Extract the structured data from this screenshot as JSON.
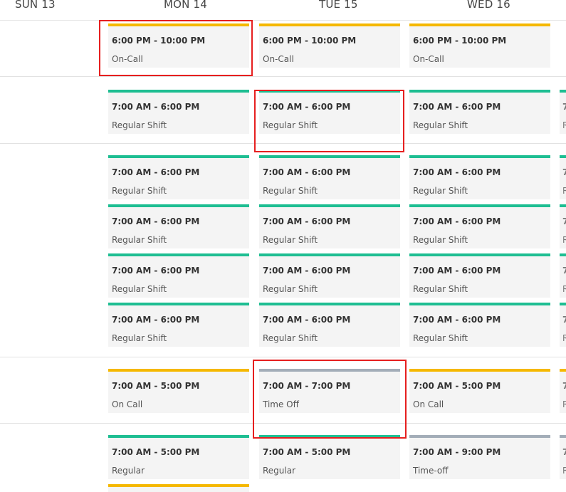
{
  "colors": {
    "regular": "#1ebe92",
    "oncall": "#f5b800",
    "timeoff": "#a3adb8",
    "highlight": "#e61f1f",
    "card_bg": "#f4f4f4"
  },
  "days": [
    {
      "label": "SUN 13"
    },
    {
      "label": "MON 14"
    },
    {
      "label": "TUE 15"
    },
    {
      "label": "WED 16"
    }
  ],
  "rows": [
    {
      "shifts": [
        {
          "time": "6:00 PM - 10:00 PM",
          "label": "On-Call",
          "color": "#f5b800"
        },
        {
          "time": "6:00 PM - 10:00 PM",
          "label": "On-Call",
          "color": "#f5b800"
        },
        {
          "time": "6:00 PM - 10:00 PM",
          "label": "On-Call",
          "color": "#f5b800"
        }
      ]
    },
    {
      "shifts": [
        {
          "time": "7:00 AM - 6:00 PM",
          "label": "Regular Shift",
          "color": "#1ebe92"
        },
        {
          "time": "7:00 AM - 6:00 PM",
          "label": "Regular Shift",
          "color": "#1ebe92"
        },
        {
          "time": "7:00 AM - 6:00 PM",
          "label": "Regular Shift",
          "color": "#1ebe92"
        }
      ]
    },
    {
      "shifts": [
        {
          "time": "7:00 AM - 6:00 PM",
          "label": "Regular Shift",
          "color": "#1ebe92"
        },
        {
          "time": "7:00 AM - 6:00 PM",
          "label": "Regular Shift",
          "color": "#1ebe92"
        },
        {
          "time": "7:00 AM - 6:00 PM",
          "label": "Regular Shift",
          "color": "#1ebe92"
        }
      ]
    },
    {
      "shifts": [
        {
          "time": "7:00 AM - 6:00 PM",
          "label": "Regular Shift",
          "color": "#1ebe92"
        },
        {
          "time": "7:00 AM - 6:00 PM",
          "label": "Regular Shift",
          "color": "#1ebe92"
        },
        {
          "time": "7:00 AM - 6:00 PM",
          "label": "Regular Shift",
          "color": "#1ebe92"
        }
      ]
    },
    {
      "shifts": [
        {
          "time": "7:00 AM - 6:00 PM",
          "label": "Regular Shift",
          "color": "#1ebe92"
        },
        {
          "time": "7:00 AM - 6:00 PM",
          "label": "Regular Shift",
          "color": "#1ebe92"
        },
        {
          "time": "7:00 AM - 6:00 PM",
          "label": "Regular Shift",
          "color": "#1ebe92"
        }
      ]
    },
    {
      "shifts": [
        {
          "time": "7:00 AM - 6:00 PM",
          "label": "Regular Shift",
          "color": "#1ebe92"
        },
        {
          "time": "7:00 AM - 6:00 PM",
          "label": "Regular Shift",
          "color": "#1ebe92"
        },
        {
          "time": "7:00 AM - 6:00 PM",
          "label": "Regular Shift",
          "color": "#1ebe92"
        }
      ]
    },
    {
      "shifts": [
        {
          "time": "7:00 AM - 5:00 PM",
          "label": "On Call",
          "color": "#f5b800"
        },
        {
          "time": "7:00 AM - 7:00 PM",
          "label": "Time Off",
          "color": "#a3adb8"
        },
        {
          "time": "7:00 AM - 5:00 PM",
          "label": "On Call",
          "color": "#f5b800"
        }
      ]
    },
    {
      "shifts": [
        {
          "time": "7:00 AM - 5:00 PM",
          "label": "Regular",
          "color": "#1ebe92"
        },
        {
          "time": "7:00 AM - 5:00 PM",
          "label": "Regular",
          "color": "#1ebe92"
        },
        {
          "time": "7:00 AM - 9:00 PM",
          "label": "Time-off",
          "color": "#a3adb8"
        }
      ]
    }
  ],
  "peek": {
    "time": "7",
    "label": "R"
  }
}
